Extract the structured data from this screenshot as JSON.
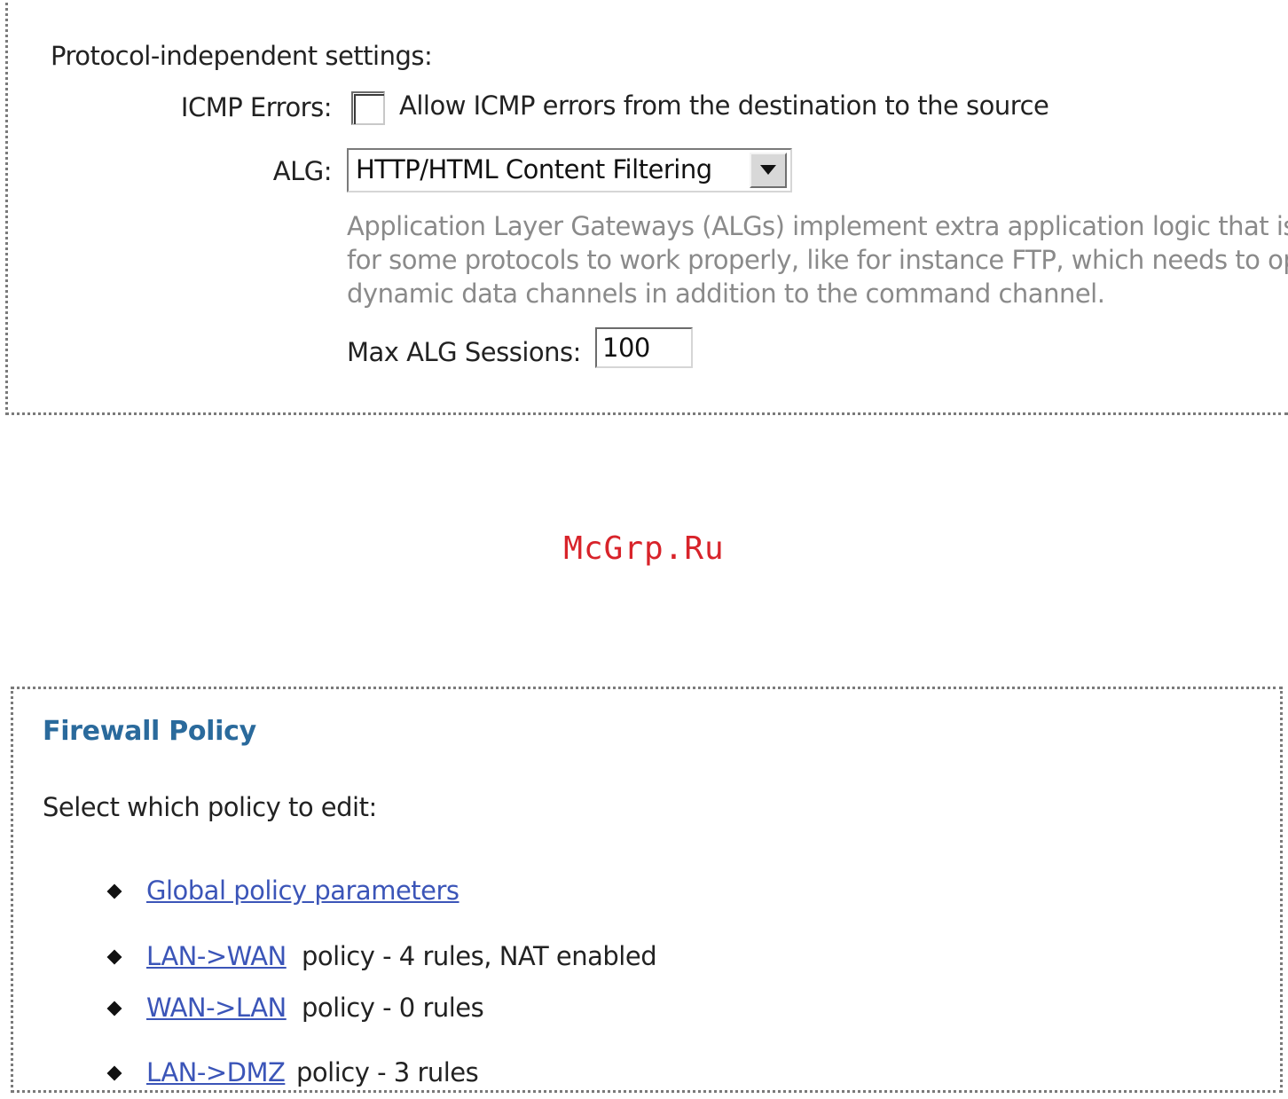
{
  "protocol_settings": {
    "heading": "Protocol-independent settings:",
    "icmp_errors_label": "ICMP Errors:",
    "icmp_errors_checked": false,
    "icmp_errors_text": "Allow ICMP errors from the destination to the source",
    "alg_label": "ALG:",
    "alg_selected": "HTTP/HTML Content Filtering",
    "alg_description": [
      "Application Layer Gateways (ALGs) implement extra application logic that is e",
      "for some protocols to work properly, like for instance FTP, which needs to op",
      "dynamic data channels in addition to the command channel."
    ],
    "max_alg_sessions_label": "Max ALG Sessions:",
    "max_alg_sessions_value": "100"
  },
  "watermark": "McGrp.Ru",
  "firewall_policy": {
    "title": "Firewall Policy",
    "intro": "Select which policy to edit:",
    "items": [
      {
        "link": "Global policy parameters",
        "rest": ""
      },
      {
        "link": "LAN->WAN",
        "rest": "policy - 4 rules, NAT enabled"
      },
      {
        "link": "WAN->LAN",
        "rest": "policy - 0 rules"
      },
      {
        "link": "LAN->DMZ",
        "rest": "policy - 3 rules"
      }
    ]
  },
  "colors": {
    "title_blue": "#2a6a9c",
    "link_blue": "#3b55b8",
    "watermark_red": "#d8232a",
    "description_gray": "#8a8a8a"
  }
}
